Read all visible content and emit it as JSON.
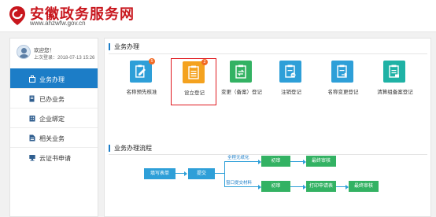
{
  "header": {
    "title": "安徽政务服务网",
    "url": "www.ahzwfw.gov.cn"
  },
  "user": {
    "welcome": "欢迎您！",
    "last_login": "上次登录：2018-07-13 15:26"
  },
  "sidebar": {
    "items": [
      {
        "label": "业务办理",
        "icon": "briefcase-icon",
        "active": true
      },
      {
        "label": "已办业务",
        "icon": "document-icon",
        "active": false
      },
      {
        "label": "企业绑定",
        "icon": "building-icon",
        "active": false
      },
      {
        "label": "相关业务",
        "icon": "file-icon",
        "active": false
      },
      {
        "label": "云证书申请",
        "icon": "monitor-icon",
        "active": false
      }
    ]
  },
  "main": {
    "section1_title": "业务办理",
    "section2_title": "业务办理流程",
    "tiles": [
      {
        "label": "名称预先核准",
        "color": "#2e9fd8",
        "badge": "5",
        "icon": "edit-doc-icon",
        "selected": false
      },
      {
        "label": "设立登记",
        "color": "#f4a21f",
        "badge": "2",
        "icon": "list-doc-icon",
        "selected": true
      },
      {
        "label": "变更（备案）登记",
        "color": "#33b263",
        "badge": "",
        "icon": "change-doc-icon",
        "selected": false
      },
      {
        "label": "注销登记",
        "color": "#2e9fd8",
        "badge": "",
        "icon": "cancel-doc-icon",
        "selected": false
      },
      {
        "label": "名称变更登记",
        "color": "#2e9fd8",
        "badge": "",
        "icon": "rename-doc-icon",
        "selected": false
      },
      {
        "label": "清算组备案登记",
        "color": "#1fb2a5",
        "badge": "",
        "icon": "liquidation-doc-icon",
        "selected": false
      }
    ]
  },
  "flow": {
    "fill_form": "填写表单",
    "submit": "提交",
    "branch_top_label": "全程无纸化",
    "branch_bottom_label": "窗口提交材料",
    "review_top": "初审",
    "final_top": "最终审核",
    "review_bottom": "初审",
    "print": "打印申请表",
    "final_bottom": "最终审核"
  },
  "colors": {
    "brand_red": "#c8161d",
    "nav_active": "#1c7dc7",
    "flow_blue": "#2e9fd8",
    "flow_green": "#33b263"
  }
}
